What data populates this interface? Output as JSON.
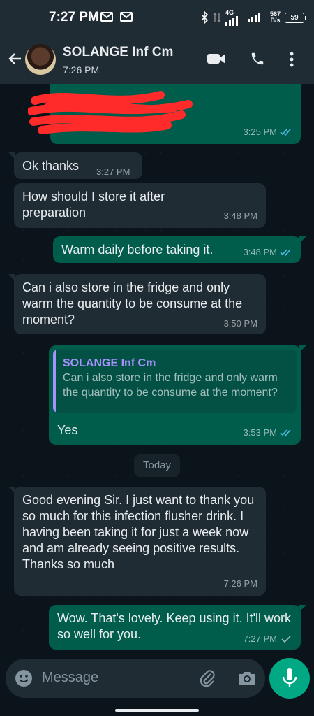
{
  "status_bar": {
    "time": "7:27 PM",
    "net_speed": "567",
    "net_unit": "B/s",
    "network": "4G",
    "battery": "59"
  },
  "header": {
    "contact_name": "SOLANGE Inf Cm",
    "last_seen": "7:26 PM"
  },
  "messages": [
    {
      "dir": "out",
      "text": "",
      "time": "3:25 PM",
      "status": "read",
      "redacted": true
    },
    {
      "dir": "in",
      "text": "Ok thanks",
      "time": "3:27 PM"
    },
    {
      "dir": "in",
      "text": "How should I store it after preparation",
      "time": "3:48 PM"
    },
    {
      "dir": "out",
      "text": "Warm daily before taking it.",
      "time": "3:48 PM",
      "status": "read"
    },
    {
      "dir": "in",
      "text": "Can i also store in the fridge and only warm the quantity to be consume at the moment?",
      "time": "3:50 PM"
    },
    {
      "dir": "out",
      "text": "Yes",
      "time": "3:53 PM",
      "status": "read",
      "quote": {
        "name": "SOLANGE Inf Cm",
        "text": "Can i also store in the fridge and only warm the quantity to be consume at the moment?"
      }
    },
    {
      "dir": "in",
      "text": "Good evening Sir. I just want to thank you so much for this infection flusher drink. I having been taking it for just a week now and am already seeing positive results. Thanks so much",
      "time": "7:26 PM"
    },
    {
      "dir": "out",
      "text": "Wow. That's lovely. Keep using it. It'll work so well for you.",
      "time": "7:27 PM",
      "status": "sent"
    }
  ],
  "date_chip": "Today",
  "input": {
    "placeholder": "Message"
  },
  "colors": {
    "incoming": "#202c33",
    "outgoing": "#005c4b",
    "read_tick": "#53bdeb",
    "accent": "#00a884"
  },
  "icons": [
    "back-arrow-icon",
    "video-call-icon",
    "phone-icon",
    "more-options-icon",
    "emoji-icon",
    "attach-icon",
    "camera-icon",
    "mic-icon",
    "read-ticks-icon",
    "sent-tick-icon"
  ]
}
